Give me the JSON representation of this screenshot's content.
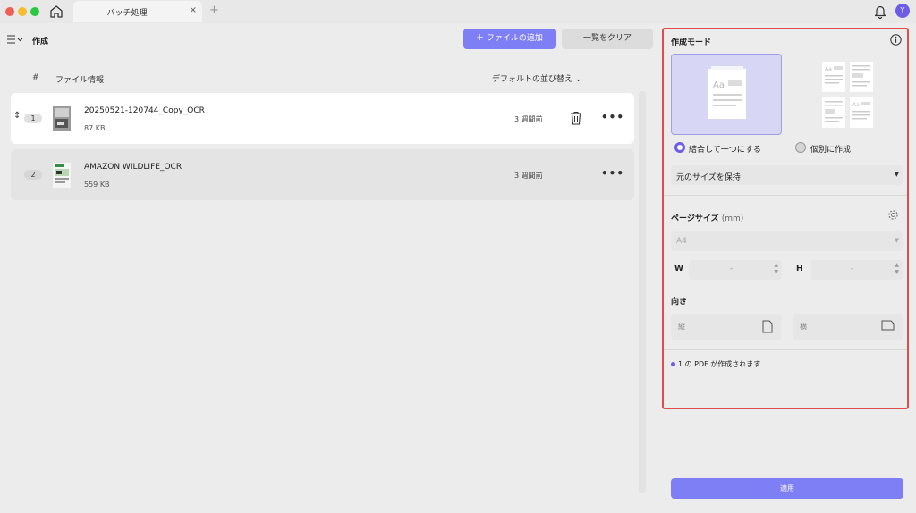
{
  "window": {
    "tab_title": "バッチ処理",
    "tab_close": "×",
    "tab_add": "+",
    "avatar_initial": "Y"
  },
  "toolbar": {
    "title": "作成",
    "add_file_label": "＋ ファイルの追加",
    "clear_list_label": "一覧をクリア"
  },
  "list": {
    "col_number": "#",
    "col_file_info": "ファイル情報",
    "sort_label": "デフォルトの並び替え",
    "files": [
      {
        "index": "1",
        "name": "20250521-120744_Copy_OCR",
        "size": "87 KB",
        "time": "3 週間前"
      },
      {
        "index": "2",
        "name": "AMAZON WILDLIFE_OCR",
        "size": "559 KB",
        "time": "3 週間前"
      }
    ]
  },
  "panel": {
    "title": "作成モード",
    "mode_combine": "結合して一つにする",
    "mode_separate": "個別に作成",
    "selected_mode": "combine",
    "size_option": "元のサイズを保持",
    "page_size_label": "ページサイズ",
    "page_size_unit": "(mm)",
    "page_size_value": "A4",
    "width_label": "W",
    "height_label": "H",
    "width_value": "-",
    "height_value": "-",
    "orientation_label": "向き",
    "portrait": "縦",
    "landscape": "横",
    "result_info": "1 の PDF が作成されます",
    "apply_label": "適用",
    "card_text": "Aa"
  },
  "colors": {
    "accent": "#7e7ef5",
    "highlight_border": "#e04b4b",
    "selected_card": "#d7d7f5"
  },
  "icons": [
    "home-icon",
    "bell-icon",
    "menu-icon",
    "trash-icon",
    "more-icon",
    "info-icon",
    "gear-icon",
    "portrait-icon",
    "landscape-icon",
    "drag-handle-icon"
  ]
}
